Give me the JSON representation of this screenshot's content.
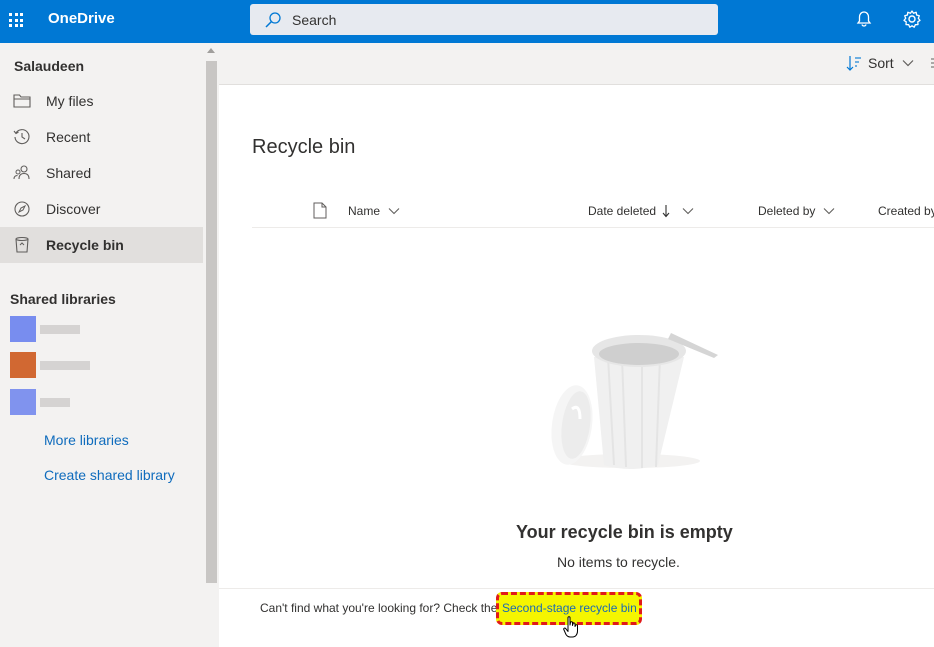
{
  "app": {
    "name": "OneDrive"
  },
  "search": {
    "placeholder": "Search"
  },
  "sidebar": {
    "user": "Salaudeen",
    "items": [
      {
        "label": "My files",
        "icon": "folder-icon"
      },
      {
        "label": "Recent",
        "icon": "history-icon"
      },
      {
        "label": "Shared",
        "icon": "people-icon"
      },
      {
        "label": "Discover",
        "icon": "compass-icon"
      },
      {
        "label": "Recycle bin",
        "icon": "recycle-bin-icon",
        "active": true
      }
    ],
    "shared_libraries_heading": "Shared libraries",
    "libraries": [
      {
        "color": "#4f6bed"
      },
      {
        "color": "#ca5010"
      },
      {
        "color": "#4f6bed"
      }
    ],
    "more_libraries": "More libraries",
    "create_library": "Create shared library"
  },
  "toolbar": {
    "sort_label": "Sort"
  },
  "main": {
    "title": "Recycle bin",
    "columns": [
      "Name",
      "Date deleted",
      "Deleted by",
      "Created by"
    ],
    "empty_title": "Your recycle bin is empty",
    "empty_subtitle": "No items to recycle.",
    "footer_text": "Can't find what you're looking for? Check the",
    "footer_link": "Second-stage recycle bin"
  },
  "colors": {
    "brand": "#0078d4",
    "sidebar_bg": "#f3f2f1",
    "highlight": "#f5f500",
    "highlight_border": "#e01a1a",
    "link": "#0f6cbd"
  }
}
